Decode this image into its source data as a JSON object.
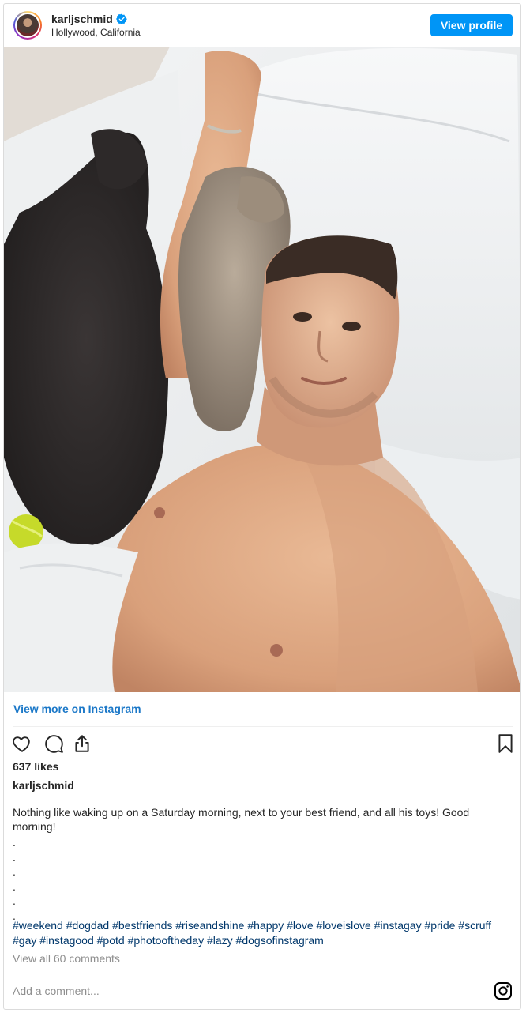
{
  "post": {
    "username": "karljschmid",
    "location": "Hollywood, California",
    "view_profile_label": "View profile",
    "view_more_label": "View more on Instagram",
    "likes": "637 likes",
    "caption_username": "karljschmid",
    "caption_text": "Nothing like waking up on a Saturday morning, next to your best friend, and all his toys! Good morning!",
    "caption_dots": [
      ".",
      ".",
      ".",
      ".",
      ".",
      "."
    ],
    "hashtags_line1": "#weekend #dogdad #bestfriends #riseandshine #happy #love #loveislove #instagay #pride #scruff",
    "hashtags_line2": "#gay #instagood #potd #photooftheday #lazy #dogsofinstagram",
    "view_comments_label": "View all 60 comments",
    "add_comment_placeholder": "Add a comment..."
  },
  "icons": {
    "verified": "verified-badge-icon",
    "like": "heart-icon",
    "comment": "comment-icon",
    "share": "share-icon",
    "save": "bookmark-icon",
    "instagram": "instagram-logo-icon"
  },
  "colors": {
    "primary_button": "#0095f6",
    "link": "#1b78c8",
    "hashtag": "#00376b",
    "muted": "#8e8e8e"
  }
}
